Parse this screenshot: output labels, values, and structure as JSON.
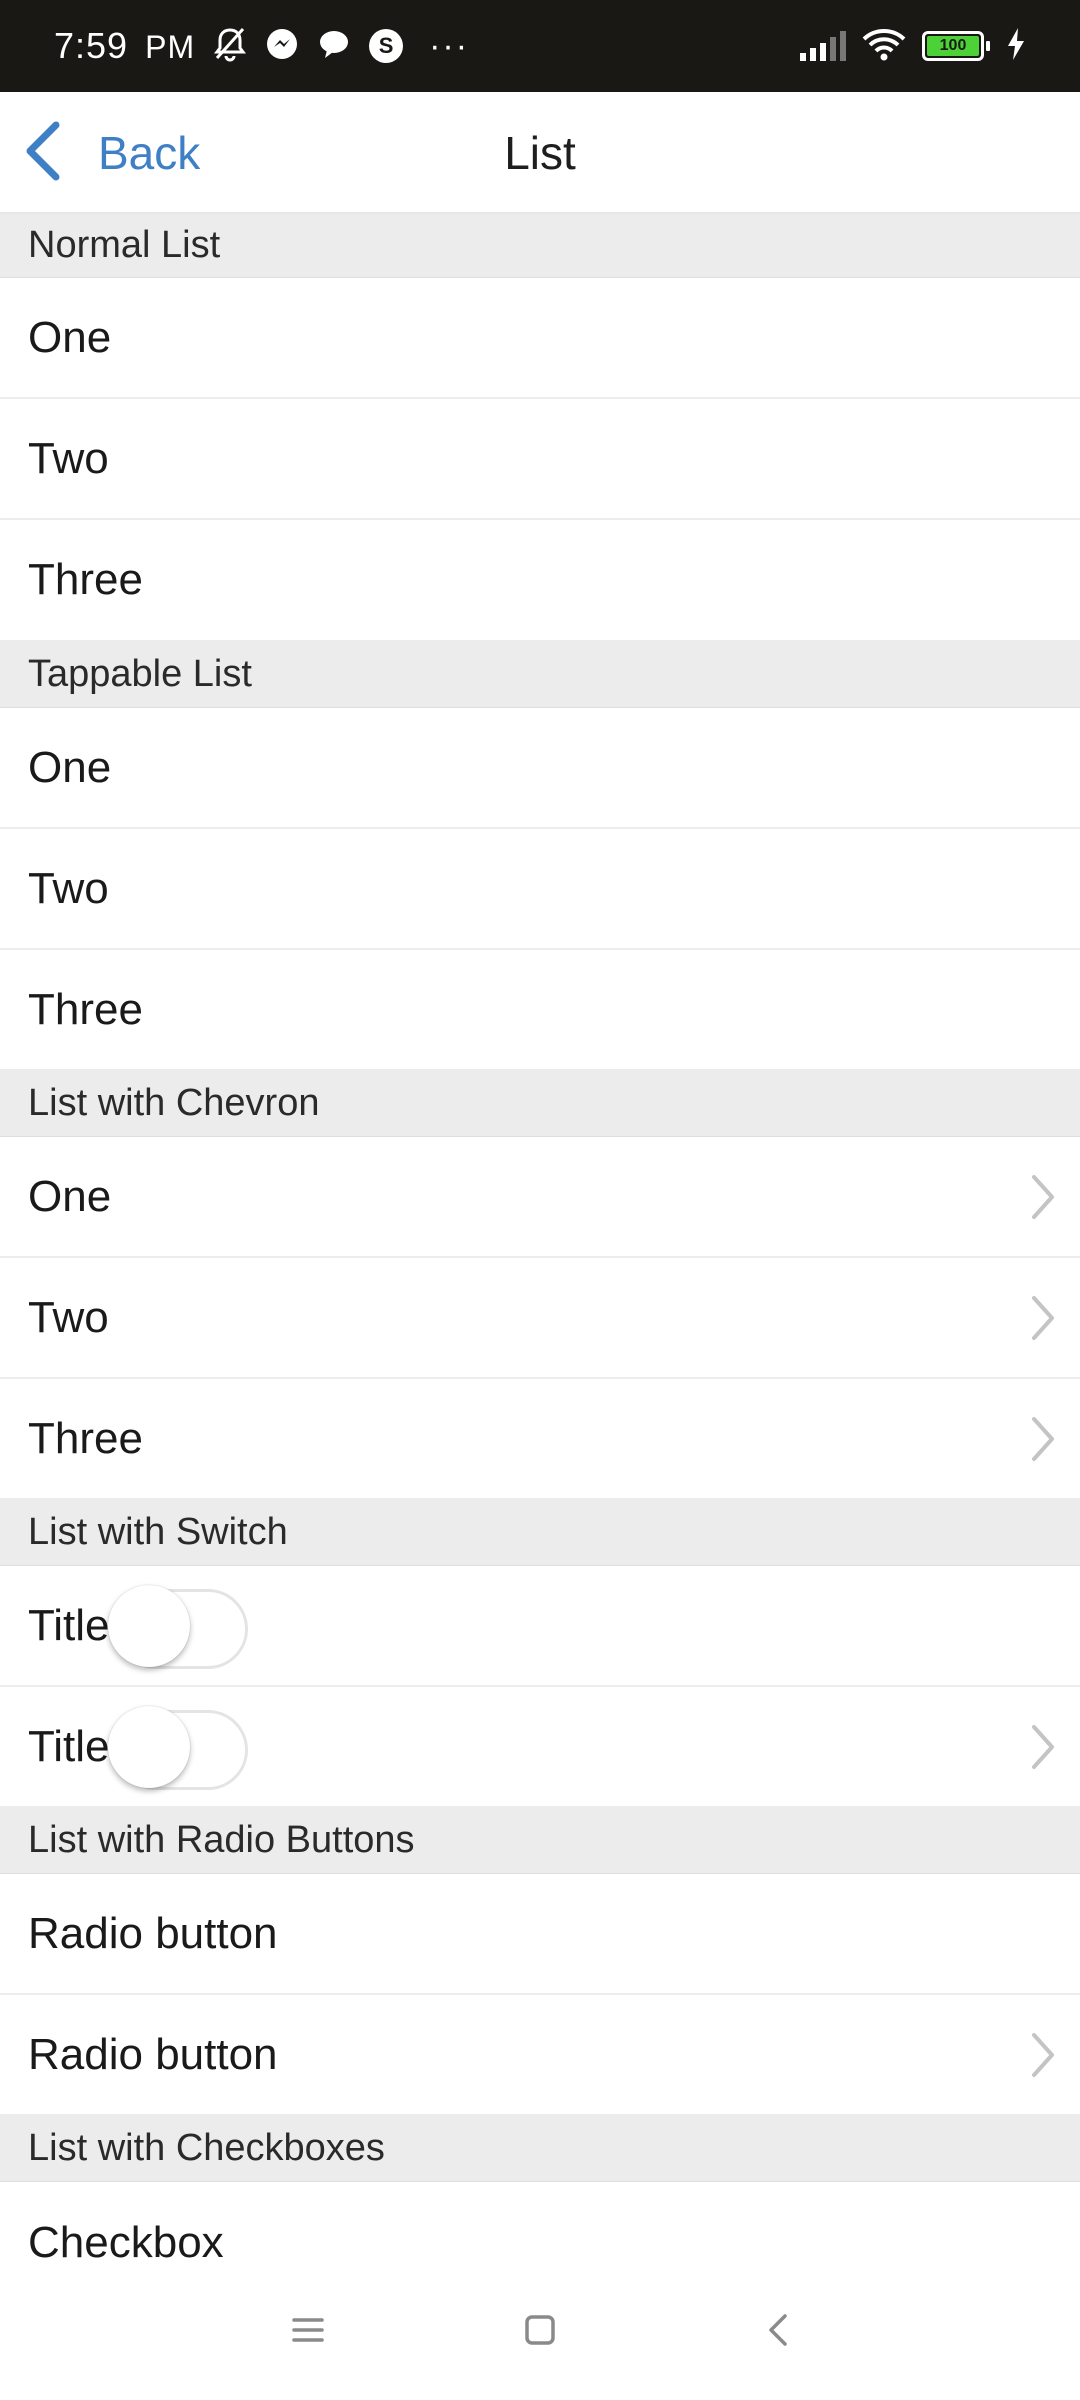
{
  "status_bar": {
    "time": "7:59",
    "ampm": "PM",
    "battery": "100",
    "app_icon_s": "S",
    "overflow": "···"
  },
  "nav": {
    "back_label": "Back",
    "title": "List"
  },
  "sections": {
    "normal": {
      "header": "Normal List",
      "items": [
        "One",
        "Two",
        "Three"
      ]
    },
    "tappable": {
      "header": "Tappable List",
      "items": [
        "One",
        "Two",
        "Three"
      ]
    },
    "chevron": {
      "header": "List with Chevron",
      "items": [
        "One",
        "Two",
        "Three"
      ]
    },
    "switch": {
      "header": "List with Switch",
      "items": [
        "Title",
        "Title"
      ]
    },
    "radio": {
      "header": "List with Radio Buttons",
      "items": [
        "Radio button",
        "Radio button"
      ]
    },
    "checkbox": {
      "header": "List with Checkboxes",
      "items": [
        "Checkbox"
      ]
    }
  },
  "colors": {
    "accent": "#3f7fc6",
    "section_bg": "#ececec",
    "status_bg": "#1a1815",
    "chevron": "#c4c4c4"
  }
}
